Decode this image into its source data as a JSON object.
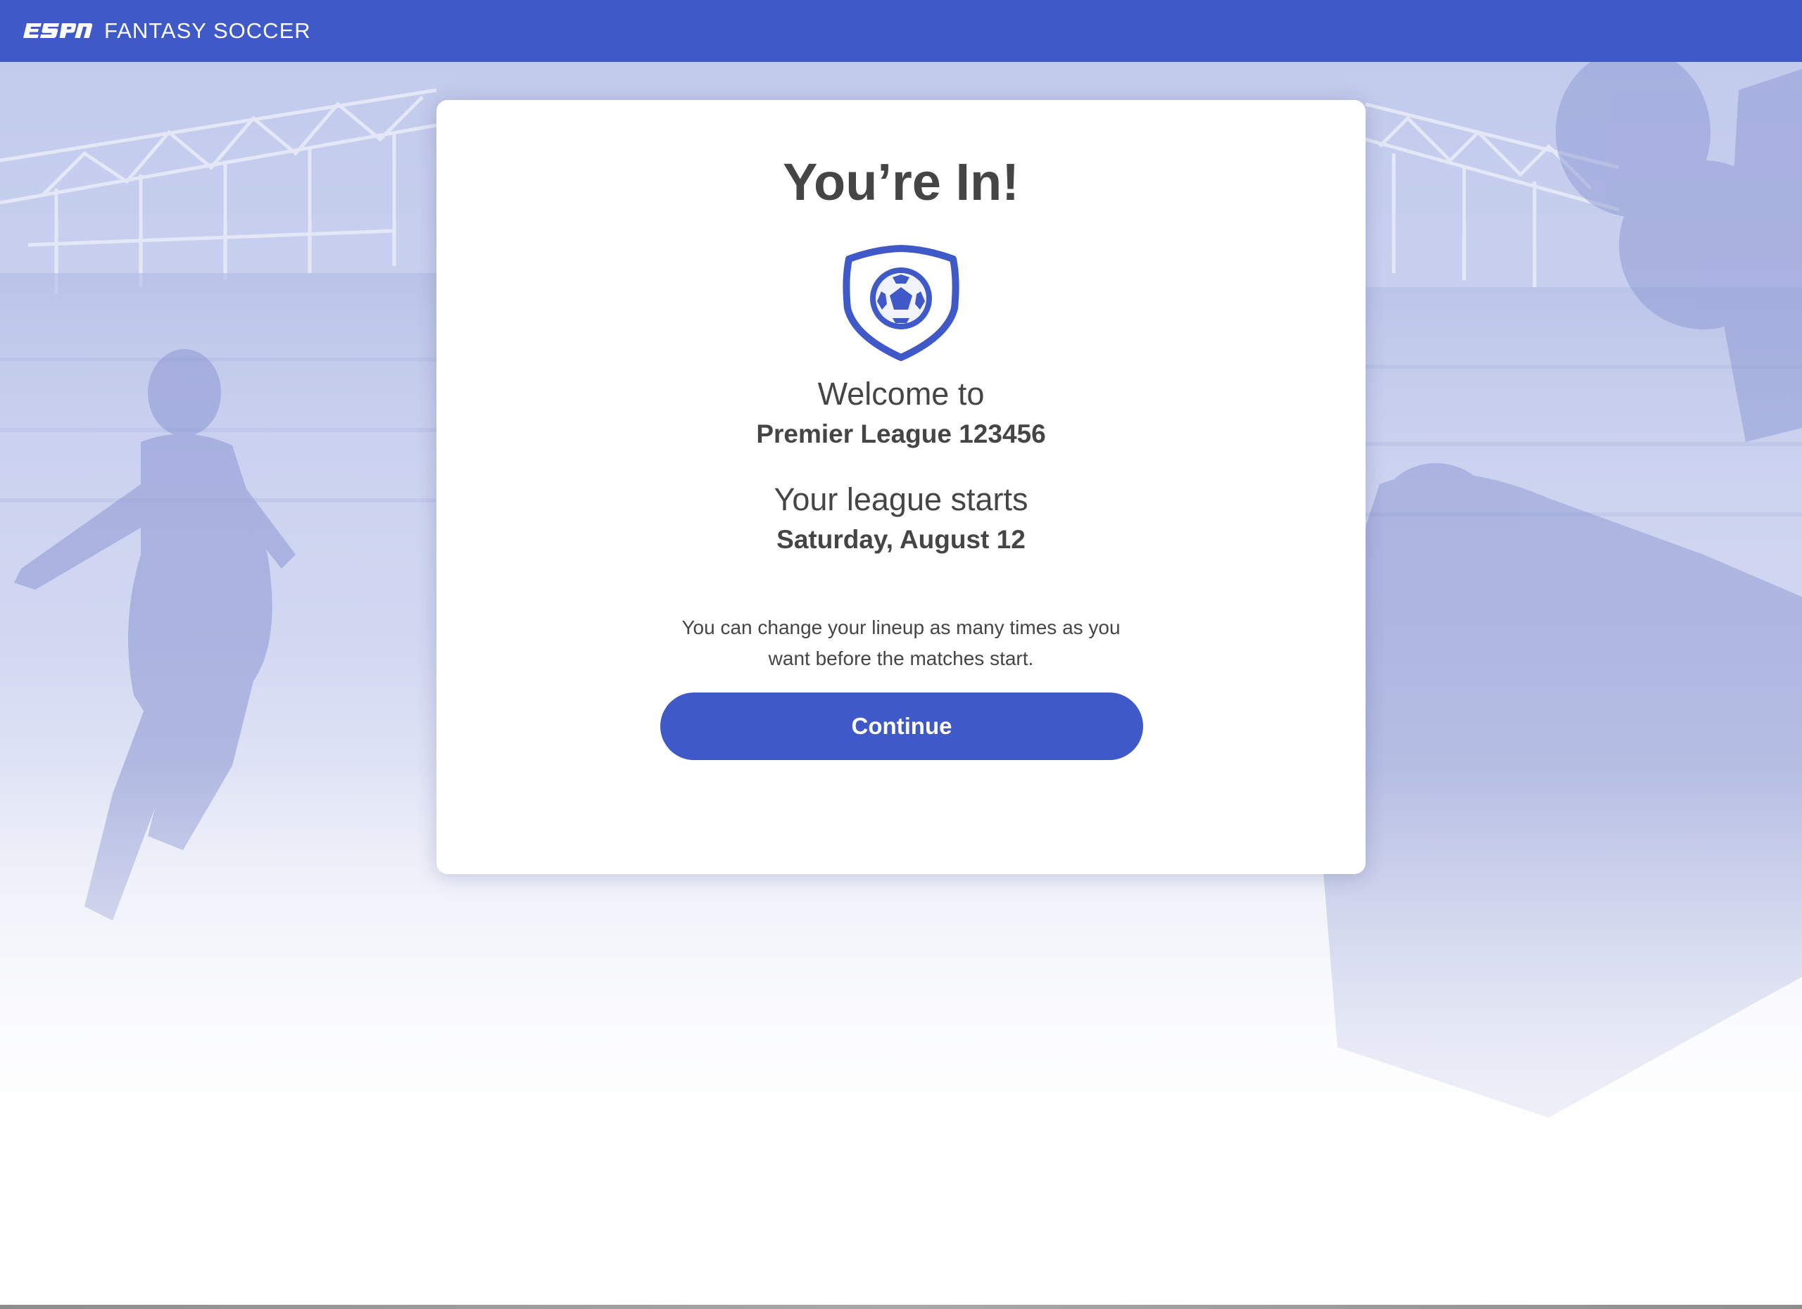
{
  "header": {
    "logo_text": "ESPN",
    "product_name": "FANTASY SOCCER",
    "background_color": "#3f59c8"
  },
  "background": {
    "description_icon": "stadium-players-image",
    "tint_color": "#c9d0ef"
  },
  "card": {
    "title": "You’re In!",
    "badge_icon": "soccer-shield-icon",
    "welcome_label": "Welcome to",
    "league_name": "Premier League 123456",
    "starts_label": "Your league starts",
    "start_date": "Saturday, August 12",
    "note": "You can change your lineup as many times as you want before the matches start.",
    "continue_label": "Continue"
  },
  "colors": {
    "accent": "#3f59c8",
    "text": "#454545",
    "card_background": "#ffffff"
  }
}
